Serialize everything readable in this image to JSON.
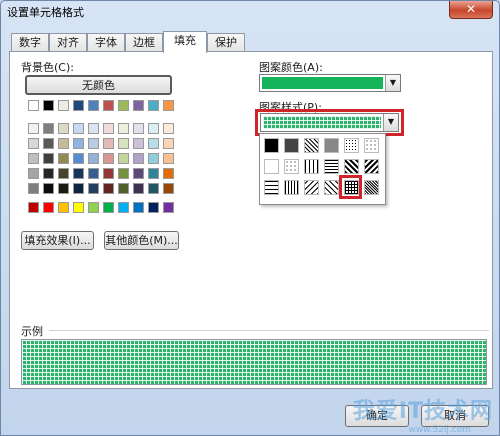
{
  "window": {
    "title": "设置单元格格式",
    "close_glyph": "✕"
  },
  "tabs": [
    {
      "label": "数字"
    },
    {
      "label": "对齐"
    },
    {
      "label": "字体"
    },
    {
      "label": "边框"
    },
    {
      "label": "填充"
    },
    {
      "label": "保护"
    }
  ],
  "fill": {
    "background_color_label": "背景色(C):",
    "no_color_button": "无颜色",
    "fill_effects_button": "填充效果(I)...",
    "more_colors_button": "其他颜色(M)...",
    "pattern_color_label": "图案颜色(A):",
    "pattern_color_value": "#14b45a",
    "pattern_style_label": "图案样式(P):",
    "selected_pattern": "thin-grid"
  },
  "sample": {
    "label": "示例"
  },
  "footer": {
    "ok": "确定",
    "cancel": "取消"
  },
  "watermark": {
    "text": "我爱IT技术网",
    "url": "www.52ij.com"
  },
  "theme_row": [
    "#ffffff",
    "#000000",
    "#eeece1",
    "#1f497d",
    "#4f81bd",
    "#c0504d",
    "#9bbb59",
    "#8064a2",
    "#4bacc6",
    "#f79646"
  ],
  "tint_rows": [
    [
      "#f2f2f2",
      "#7f7f7f",
      "#ddd9c3",
      "#c6d9f0",
      "#dbe5f1",
      "#f2dcdb",
      "#ebf1dd",
      "#e5e0ec",
      "#dbeef3",
      "#fdeada"
    ],
    [
      "#d8d8d8",
      "#595959",
      "#c4bd97",
      "#8db3e2",
      "#b8cce4",
      "#e5b9b7",
      "#d7e3bc",
      "#ccc1d9",
      "#b7dde8",
      "#fbd5b5"
    ],
    [
      "#bfbfbf",
      "#3f3f3f",
      "#938953",
      "#548dd4",
      "#95b3d7",
      "#d99694",
      "#c3d69b",
      "#b2a2c7",
      "#92cddc",
      "#fac08f"
    ],
    [
      "#a5a5a5",
      "#262626",
      "#494429",
      "#17365d",
      "#366092",
      "#953734",
      "#76923c",
      "#5f497a",
      "#31859b",
      "#e36c09"
    ],
    [
      "#7f7f7f",
      "#0c0c0c",
      "#1d1b10",
      "#0f243e",
      "#244061",
      "#632423",
      "#4f6128",
      "#3f3151",
      "#205867",
      "#974806"
    ]
  ],
  "standard_row": [
    "#c00000",
    "#ff0000",
    "#ffc000",
    "#ffff00",
    "#92d050",
    "#00b050",
    "#00b0f0",
    "#0070c0",
    "#002060",
    "#7030a0"
  ]
}
